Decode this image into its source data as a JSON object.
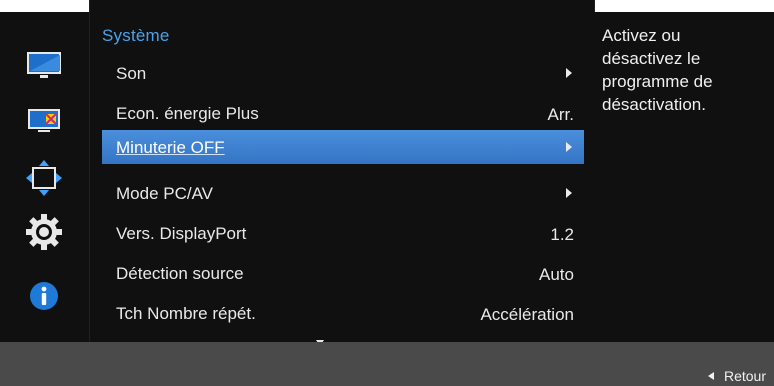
{
  "menu": {
    "title": "Système",
    "items": [
      {
        "label": "Son",
        "value": "",
        "has_arrow": true
      },
      {
        "label": "Econ. énergie Plus",
        "value": "Arr.",
        "has_arrow": false
      },
      {
        "label": "Minuterie OFF",
        "value": "",
        "has_arrow": true,
        "selected": true
      },
      {
        "label": "Mode PC/AV",
        "value": "",
        "has_arrow": true
      },
      {
        "label": "Vers. DisplayPort",
        "value": "1.2",
        "has_arrow": false
      },
      {
        "label": "Détection source",
        "value": "Auto",
        "has_arrow": false
      },
      {
        "label": "Tch Nombre répét.",
        "value": "Accélération",
        "has_arrow": false
      }
    ]
  },
  "help": {
    "text_lines": [
      "Activez ou",
      "désactivez le",
      "programme de",
      "désactivation."
    ]
  },
  "footer": {
    "back_label": "Retour"
  },
  "sidebar": {
    "icons": [
      "monitor-icon",
      "color-icon",
      "position-icon",
      "settings-gear-icon",
      "info-icon"
    ]
  },
  "colors": {
    "accent": "#4aa3ea",
    "selected": "#3f82d0",
    "panel": "#101010",
    "frame": "#4a4a4a"
  }
}
